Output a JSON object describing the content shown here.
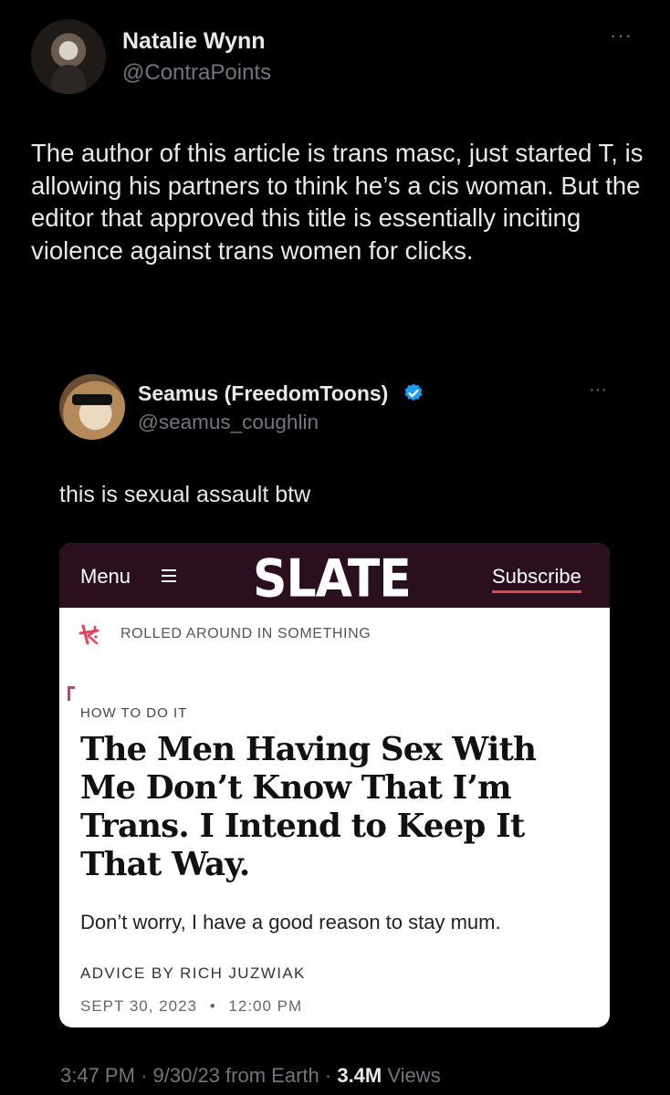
{
  "tweet": {
    "author_name": "Natalie Wynn",
    "author_handle": "@ContraPoints",
    "more_label": "···",
    "text": "The author of this article is trans masc, just started T, is allowing his partners to think he’s a cis woman. But the editor that approved this title is essentially inciting violence against trans women for clicks.",
    "time": "3:47 PM",
    "date": "9/30/23",
    "source": "from Earth",
    "views_count": "3.4M",
    "views_label": "Views",
    "separator": "·"
  },
  "quote": {
    "author_name": "Seamus (FreedomToons)",
    "author_handle": "@seamus_coughlin",
    "more_label": "···",
    "verified_color": "#1d9bf0",
    "text": "this is sexual assault btw"
  },
  "card": {
    "menu_label": "Menu",
    "logo": "SLATE",
    "subscribe_label": "Subscribe",
    "section_label": "ROLLED AROUND IN SOMETHING",
    "kicker": "HOW TO DO IT",
    "headline": "The Men Having Sex With Me Don’t Know That I’m Trans. I Intend to Keep It That Way.",
    "dek": "Don’t worry, I have a good reason to stay mum.",
    "byline": "ADVICE BY RICH JUZWIAK",
    "date": "SEPT 30, 2023",
    "date_separator": "•",
    "time": "12:00 PM",
    "header_color": "#2a0f1f",
    "accent_color": "#e8425a"
  }
}
